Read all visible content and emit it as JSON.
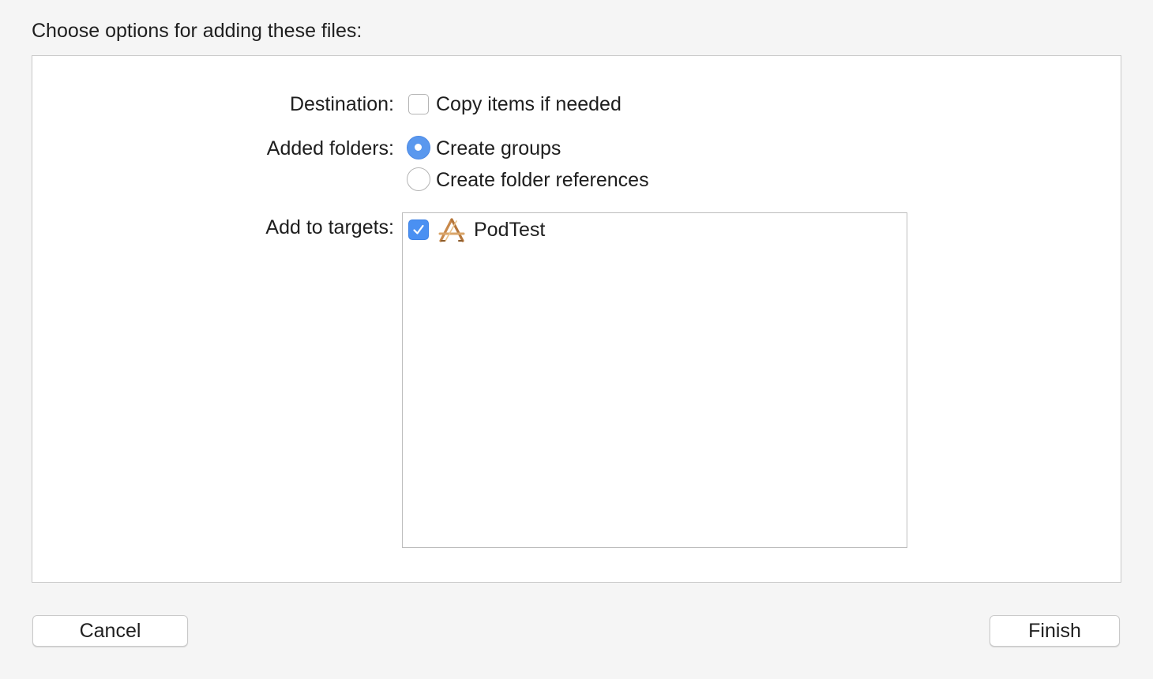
{
  "dialog": {
    "heading": "Choose options for adding these files:"
  },
  "destination": {
    "label": "Destination:",
    "copy_items_label": "Copy items if needed",
    "copy_items_checked": false
  },
  "added_folders": {
    "label": "Added folders:",
    "options": [
      {
        "label": "Create groups",
        "selected": true
      },
      {
        "label": "Create folder references",
        "selected": false
      }
    ]
  },
  "targets": {
    "label": "Add to targets:",
    "items": [
      {
        "name": "PodTest",
        "checked": true,
        "icon": "app-target-icon"
      }
    ]
  },
  "buttons": {
    "cancel": "Cancel",
    "finish": "Finish"
  },
  "colors": {
    "accent": "#4a90f2",
    "background": "#f5f5f5",
    "panel": "#ffffff"
  }
}
